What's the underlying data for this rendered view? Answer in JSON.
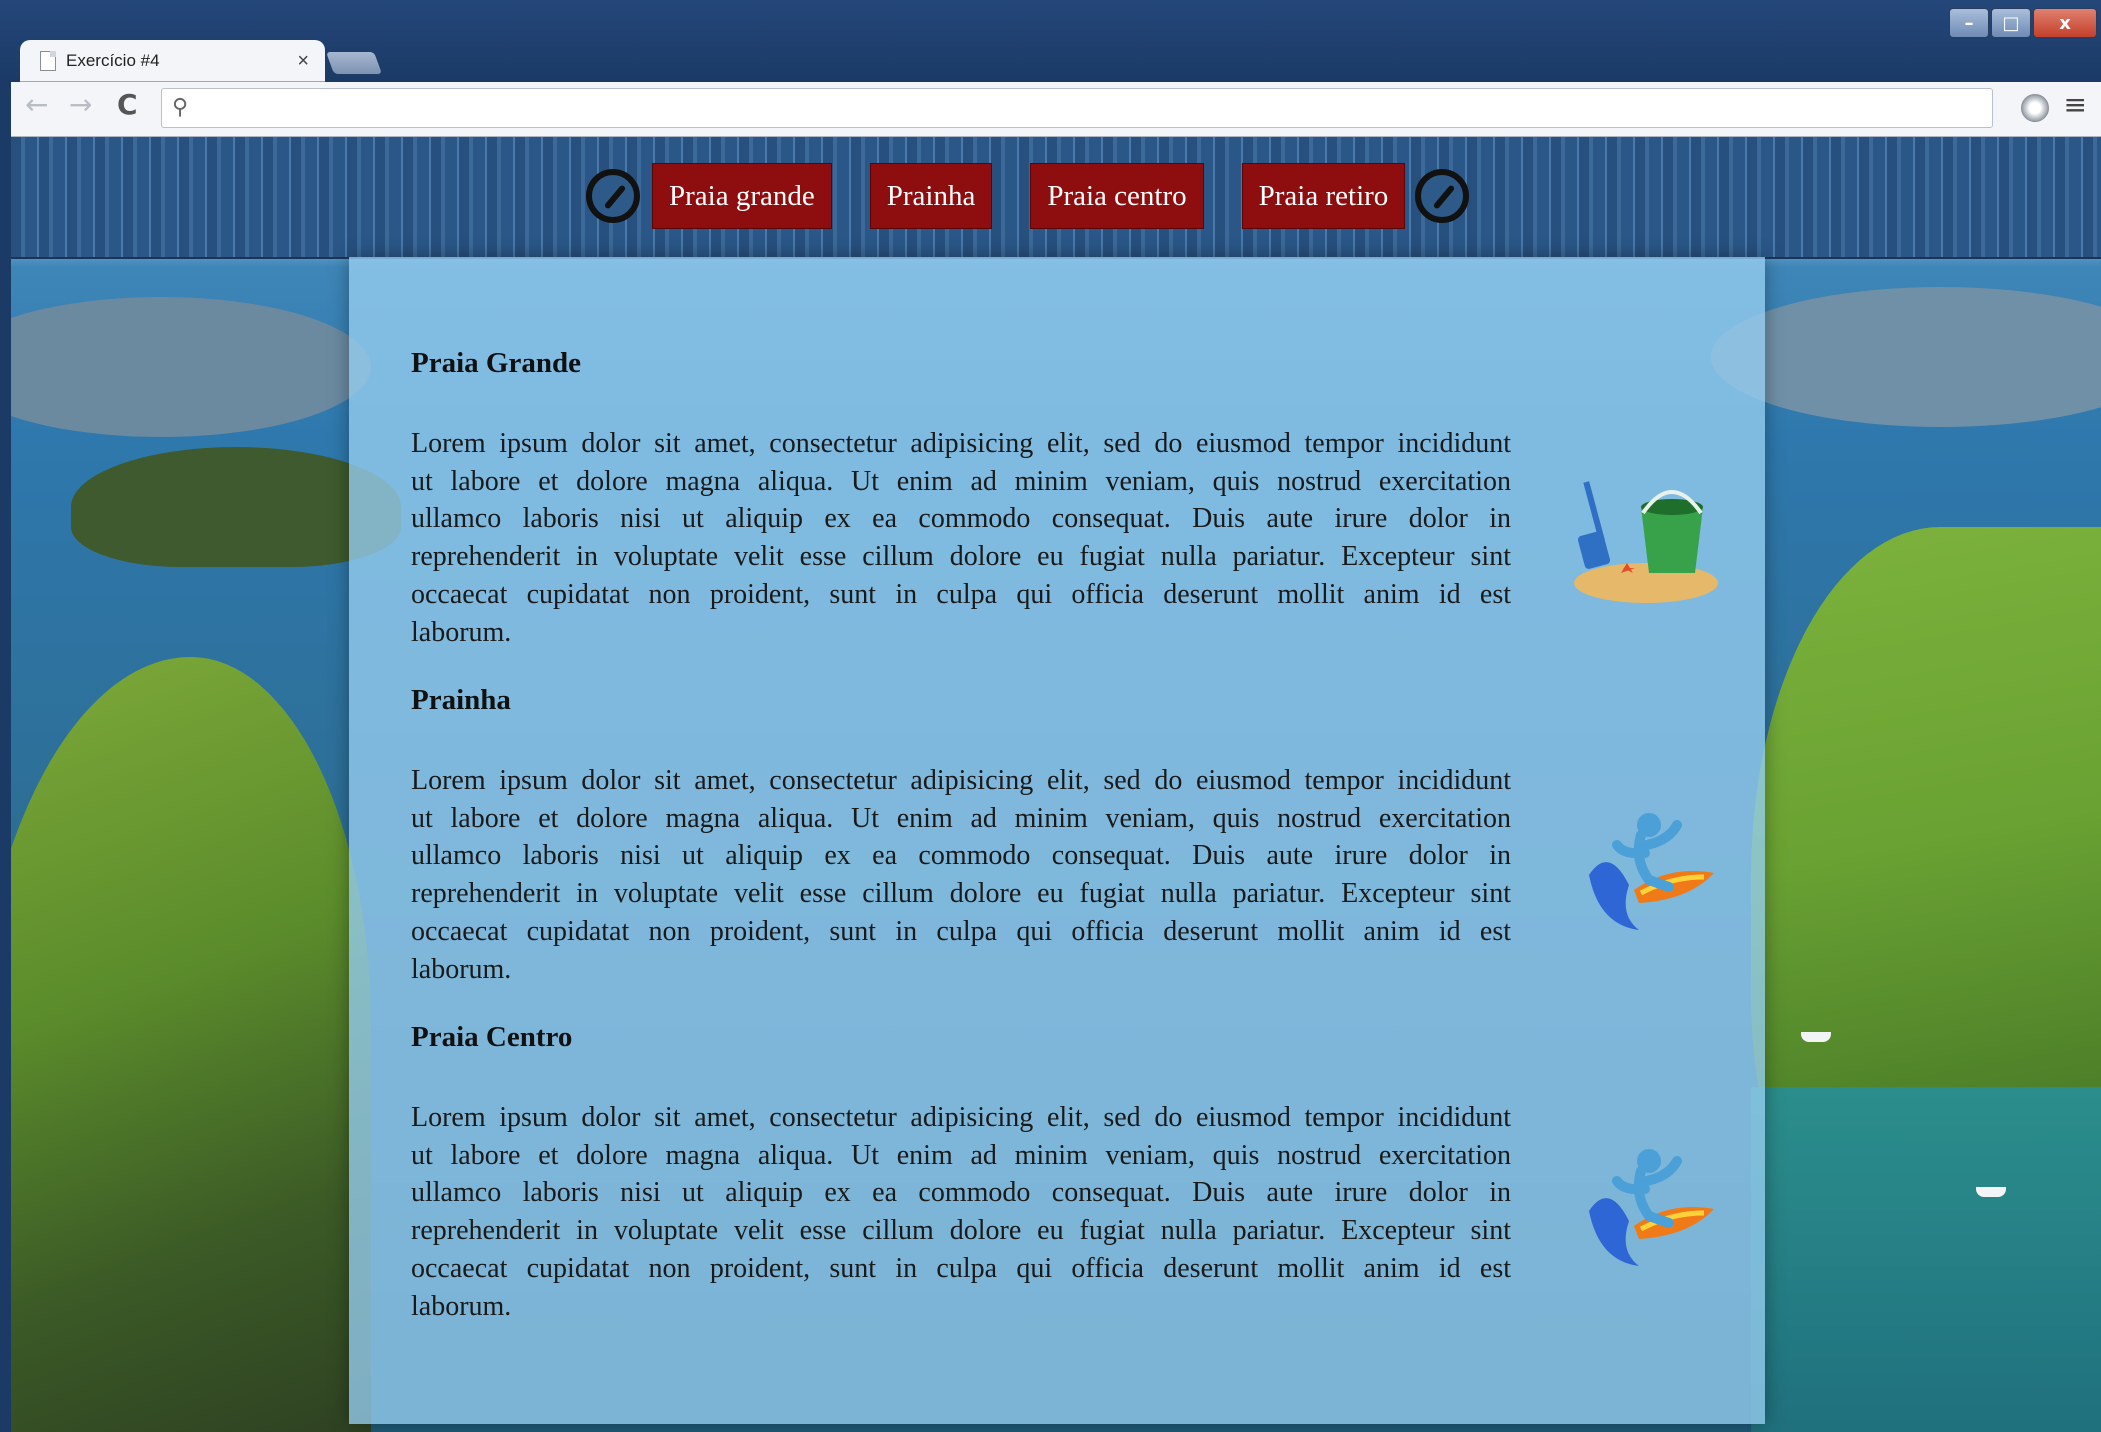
{
  "browser": {
    "tab_title": "Exercício #4",
    "tab_close": "×",
    "address_value": "",
    "window_controls": {
      "minimize": "–",
      "maximize": "□",
      "close": "x"
    },
    "back": "←",
    "forward": "→",
    "reload": "C",
    "menu": "≡",
    "search_glyph": "⚲"
  },
  "nav": {
    "links": [
      "Praia grande",
      "Prainha",
      "Praia centro",
      "Praia retiro"
    ],
    "bar_color": "#2a5788",
    "link_color": "#8e0e10"
  },
  "content": {
    "sections": [
      {
        "title": "Praia Grande",
        "text": "Lorem ipsum dolor sit amet, consectetur adipisicing elit, sed do eiusmod tempor incididunt ut labore et dolore magna aliqua. Ut enim ad minim veniam, quis nostrud exercitation ullamco laboris nisi ut aliquip ex ea commodo consequat. Duis aute irure dolor in reprehenderit in voluptate velit esse cillum dolore eu fugiat nulla pariatur. Excepteur sint occaecat cupidatat non proident, sunt in culpa qui officia deserunt mollit anim id est laborum.",
        "icon": "beach-bucket-icon"
      },
      {
        "title": "Prainha",
        "text": "Lorem ipsum dolor sit amet, consectetur adipisicing elit, sed do eiusmod tempor incididunt ut labore et dolore magna aliqua. Ut enim ad minim veniam, quis nostrud exercitation ullamco laboris nisi ut aliquip ex ea commodo consequat. Duis aute irure dolor in reprehenderit in voluptate velit esse cillum dolore eu fugiat nulla pariatur. Excepteur sint occaecat cupidatat non proident, sunt in culpa qui officia deserunt mollit anim id est laborum.",
        "icon": "surfer-icon"
      },
      {
        "title": "Praia Centro",
        "text": "Lorem ipsum dolor sit amet, consectetur adipisicing elit, sed do eiusmod tempor incididunt ut labore et dolore magna aliqua. Ut enim ad minim veniam, quis nostrud exercitation ullamco laboris nisi ut aliquip ex ea commodo consequat. Duis aute irure dolor in reprehenderit in voluptate velit esse cillum dolore eu fugiat nulla pariatur. Excepteur sint occaecat cupidatat non proident, sunt in culpa qui officia deserunt mollit anim id est laborum.",
        "icon": "surfer-icon"
      }
    ]
  }
}
